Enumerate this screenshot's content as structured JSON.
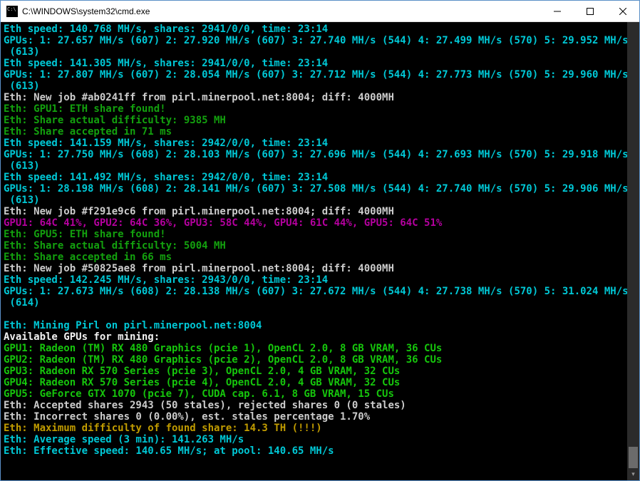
{
  "window": {
    "title": "C:\\WINDOWS\\system32\\cmd.exe"
  },
  "lines": [
    {
      "cls": "c-cyan",
      "text": "Eth speed: 140.768 MH/s, shares: 2941/0/0, time: 23:14"
    },
    {
      "cls": "c-cyan",
      "text": "GPUs: 1: 27.657 MH/s (607) 2: 27.920 MH/s (607) 3: 27.740 MH/s (544) 4: 27.499 MH/s (570) 5: 29.952 MH/s (613)"
    },
    {
      "cls": "c-cyan",
      "text": "Eth speed: 141.305 MH/s, shares: 2941/0/0, time: 23:14"
    },
    {
      "cls": "c-cyan",
      "text": "GPUs: 1: 27.807 MH/s (607) 2: 28.054 MH/s (607) 3: 27.712 MH/s (544) 4: 27.773 MH/s (570) 5: 29.960 MH/s (613)"
    },
    {
      "cls": "c-white",
      "text": "Eth: New job #ab0241ff from pirl.minerpool.net:8004; diff: 4000MH"
    },
    {
      "cls": "c-green",
      "text": "Eth: GPU1: ETH share found!"
    },
    {
      "cls": "c-green",
      "text": "Eth: Share actual difficulty: 9385 MH"
    },
    {
      "cls": "c-green",
      "text": "Eth: Share accepted in 71 ms"
    },
    {
      "cls": "c-cyan",
      "text": "Eth speed: 141.159 MH/s, shares: 2942/0/0, time: 23:14"
    },
    {
      "cls": "c-cyan",
      "text": "GPUs: 1: 27.750 MH/s (608) 2: 28.103 MH/s (607) 3: 27.696 MH/s (544) 4: 27.693 MH/s (570) 5: 29.918 MH/s (613)"
    },
    {
      "cls": "c-cyan",
      "text": "Eth speed: 141.492 MH/s, shares: 2942/0/0, time: 23:14"
    },
    {
      "cls": "c-cyan",
      "text": "GPUs: 1: 28.198 MH/s (608) 2: 28.141 MH/s (607) 3: 27.508 MH/s (544) 4: 27.740 MH/s (570) 5: 29.906 MH/s (613)"
    },
    {
      "cls": "c-white",
      "text": "Eth: New job #f291e9c6 from pirl.minerpool.net:8004; diff: 4000MH"
    },
    {
      "cls": "c-magenta",
      "text": "GPU1: 64C 41%, GPU2: 64C 36%, GPU3: 58C 44%, GPU4: 61C 44%, GPU5: 64C 51%"
    },
    {
      "cls": "c-green",
      "text": "Eth: GPU5: ETH share found!"
    },
    {
      "cls": "c-green",
      "text": "Eth: Share actual difficulty: 5004 MH"
    },
    {
      "cls": "c-green",
      "text": "Eth: Share accepted in 66 ms"
    },
    {
      "cls": "c-white",
      "text": "Eth: New job #50825ae8 from pirl.minerpool.net:8004; diff: 4000MH"
    },
    {
      "cls": "c-cyan",
      "text": "Eth speed: 142.245 MH/s, shares: 2943/0/0, time: 23:14"
    },
    {
      "cls": "c-cyan",
      "text": "GPUs: 1: 27.673 MH/s (608) 2: 28.138 MH/s (607) 3: 27.672 MH/s (544) 4: 27.738 MH/s (570) 5: 31.024 MH/s (614)"
    },
    {
      "cls": "",
      "text": " "
    },
    {
      "cls": "c-cyan",
      "text": "Eth: Mining Pirl on pirl.minerpool.net:8004"
    },
    {
      "cls": "c-bwhite",
      "text": "Available GPUs for mining:"
    },
    {
      "cls": "c-bgreen",
      "text": "GPU1: Radeon (TM) RX 480 Graphics (pcie 1), OpenCL 2.0, 8 GB VRAM, 36 CUs"
    },
    {
      "cls": "c-bgreen",
      "text": "GPU2: Radeon (TM) RX 480 Graphics (pcie 2), OpenCL 2.0, 8 GB VRAM, 36 CUs"
    },
    {
      "cls": "c-bgreen",
      "text": "GPU3: Radeon RX 570 Series (pcie 3), OpenCL 2.0, 4 GB VRAM, 32 CUs"
    },
    {
      "cls": "c-bgreen",
      "text": "GPU4: Radeon RX 570 Series (pcie 4), OpenCL 2.0, 4 GB VRAM, 32 CUs"
    },
    {
      "cls": "c-bgreen",
      "text": "GPU5: GeForce GTX 1070 (pcie 7), CUDA cap. 6.1, 8 GB VRAM, 15 CUs"
    },
    {
      "cls": "c-white",
      "text": "Eth: Accepted shares 2943 (50 stales), rejected shares 0 (0 stales)"
    },
    {
      "cls": "c-white",
      "text": "Eth: Incorrect shares 0 (0.00%), est. stales percentage 1.70%"
    },
    {
      "cls": "c-yellow",
      "text": "Eth: Maximum difficulty of found share: 14.3 TH (!!!)"
    },
    {
      "cls": "c-cyan",
      "text": "Eth: Average speed (3 min): 141.263 MH/s"
    },
    {
      "cls": "c-cyan",
      "text": "Eth: Effective speed: 140.65 MH/s; at pool: 140.65 MH/s"
    }
  ]
}
